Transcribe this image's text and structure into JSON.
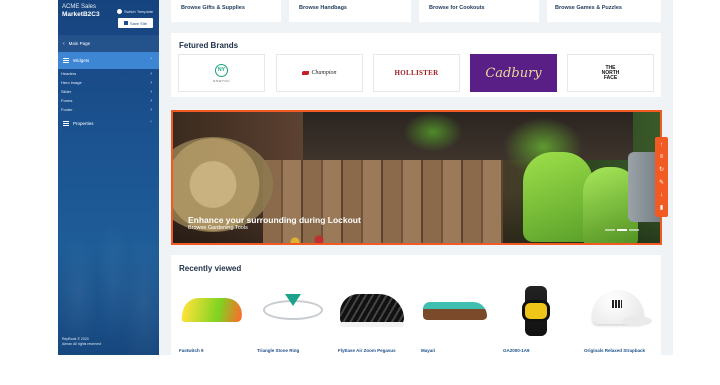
{
  "sidebar": {
    "org": "ACME Sales",
    "site": "MarketB2C3",
    "switch_label": "Switch Template",
    "save_label": "Save Site",
    "main_page": "Main Page",
    "widgets_label": "Widgets",
    "widget_items": [
      "Headers",
      "Hero image",
      "Slider",
      "Forms",
      "Footer"
    ],
    "properties_label": "Properties",
    "footer_line1": "RepBook © 2020",
    "footer_line2": "Aleran All rights reserved"
  },
  "categories": [
    "Browse Gifts & Supplies",
    "Browse Handbags",
    "Browse for Cookouts",
    "Browse Games & Puzzles"
  ],
  "brands": {
    "title": "Fetured Brands",
    "items": [
      {
        "name": "Nowyou",
        "mark": "NY",
        "text": "NOWYOU"
      },
      {
        "name": "Champion",
        "text": "Champion"
      },
      {
        "name": "Hollister",
        "text": "HOLLISTER"
      },
      {
        "name": "Cadbury",
        "text": "Cadbury"
      },
      {
        "name": "The North Face",
        "text_lines": [
          "THE",
          "NORTH",
          "FACE"
        ]
      }
    ]
  },
  "banner": {
    "headline": "Enhance your surrounding during Lockout",
    "subline": "Browse Gardening Tools",
    "slide_count": 3,
    "active_slide": 1,
    "accent_color": "#f15a22"
  },
  "toolbar_icons": [
    "arrow-up-icon",
    "list-icon",
    "history-icon",
    "edit-icon",
    "arrow-down-icon",
    "trash-icon"
  ],
  "recent": {
    "title": "Recently viewed",
    "products": [
      {
        "name": "Fastwitch 9"
      },
      {
        "name": "Triangle Stone Ring"
      },
      {
        "name": "FlyEase Air Zoom Pegasus"
      },
      {
        "name": "Mayari"
      },
      {
        "name": "GA2000-1A9"
      },
      {
        "name": "Originals Relaxed Strapback"
      }
    ]
  },
  "colors": {
    "sidebar": "#1b5390",
    "sidebar_active": "#3d86d4",
    "accent": "#f15a22",
    "link": "#1e4f8a"
  }
}
